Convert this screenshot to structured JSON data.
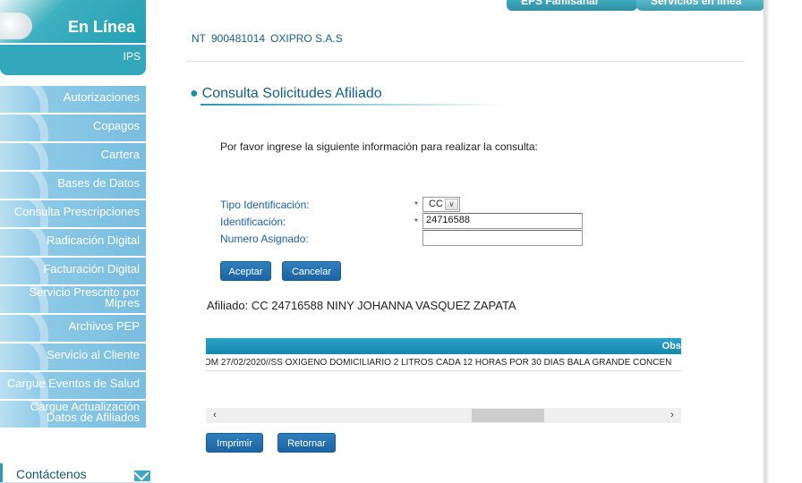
{
  "top_tabs": [
    "EPS Famisanar",
    "Servicios en línea"
  ],
  "logo": {
    "title": "En Línea",
    "subtitle": "IPS"
  },
  "sidebar": {
    "items": [
      {
        "label": "Autorizaciones"
      },
      {
        "label": "Copagos"
      },
      {
        "label": "Cartera"
      },
      {
        "label": "Bases de Datos"
      },
      {
        "label": "Consulta Prescripciones"
      },
      {
        "label": "Radicación Digital"
      },
      {
        "label": "Facturación Digital"
      },
      {
        "label": "Servicio Prescrito por Mipres"
      },
      {
        "label": "Archivos PEP"
      },
      {
        "label": "Servicio al Cliente"
      },
      {
        "label": "Cargue Eventos de Salud"
      },
      {
        "label": "Cargue Actualización Datos de Afiliados"
      }
    ],
    "contact": "Contáctenos"
  },
  "company": {
    "nit_label": "NT",
    "nit": "900481014",
    "name": "OXIPRO S.A.S"
  },
  "section_title": "Consulta Solicitudes Afiliado",
  "instructions": "Por favor ingrese la siguiente información para realizar la consulta:",
  "form": {
    "tipo_label": "Tipo Identificación:",
    "tipo_value": "CC",
    "id_label": "Identificación:",
    "id_value": "24716588",
    "numero_label": "Numero Asignado:",
    "numero_value": "",
    "required_mark": "*",
    "aceptar": "Aceptar",
    "cancelar": "Cancelar"
  },
  "afiliado": "Afiliado: CC 24716588 NINY JOHANNA VASQUEZ ZAPATA",
  "grid": {
    "header": "Obs",
    "row_text": "OM 27/02/2020//SS OXIGENO DOMICILIARIO 2 LITROS CADA 12 HORAS POR 30 DIAS BALA GRANDE CONCEN"
  },
  "scroll_left": "‹",
  "scroll_right": "›",
  "buttons": {
    "imprimir": "Imprimir",
    "retornar": "Retornar"
  },
  "colors": {
    "accent": "#1f9ab2",
    "link": "#1a62a6",
    "button": "#1d64a3",
    "menu": "#79bde0"
  }
}
